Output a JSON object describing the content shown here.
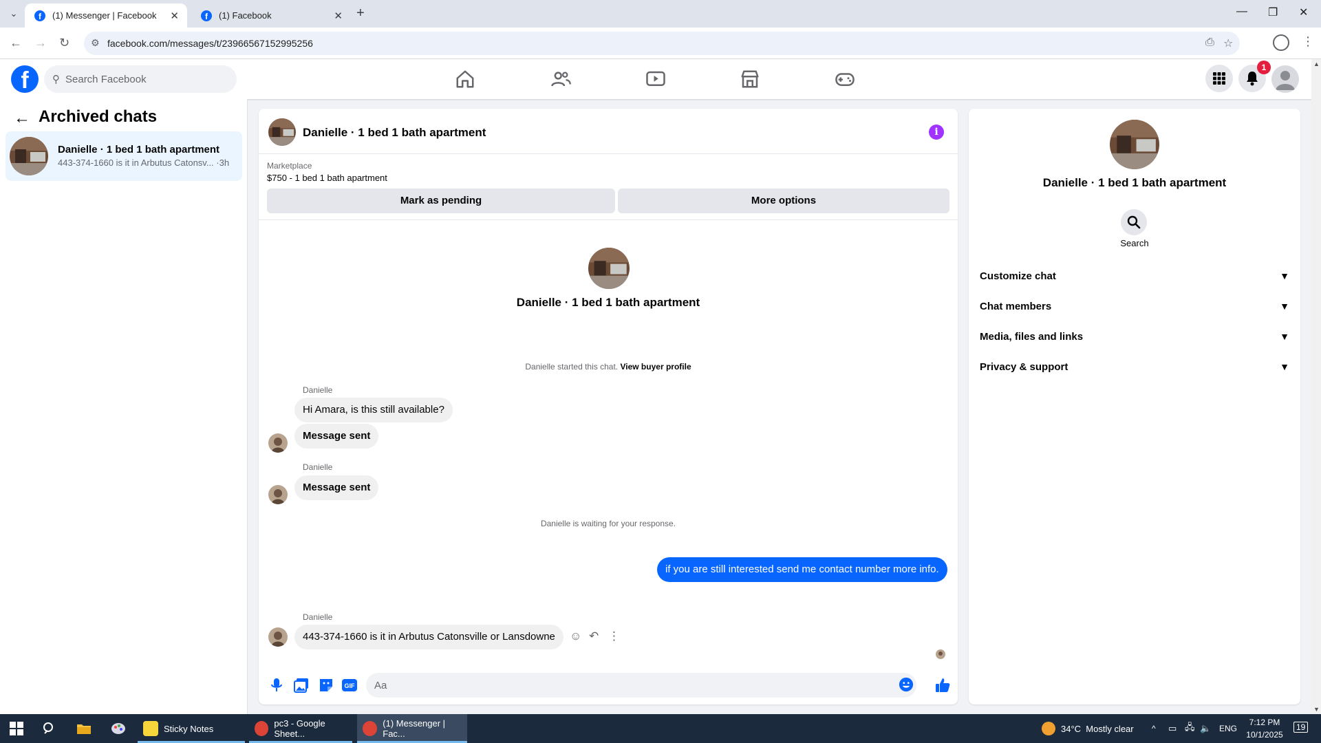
{
  "browser": {
    "tabs": [
      {
        "title": "(1) Messenger | Facebook",
        "active": true
      },
      {
        "title": "(1) Facebook",
        "active": false
      }
    ],
    "url": "facebook.com/messages/t/23966567152995256"
  },
  "header": {
    "search_placeholder": "Search Facebook",
    "notification_count": "1"
  },
  "left_panel": {
    "title": "Archived chats",
    "chats": [
      {
        "name": "Danielle · 1 bed 1 bath apartment",
        "preview": "443-374-1660 is it in Arbutus Catonsv... ·3h"
      }
    ]
  },
  "chat": {
    "title": "Danielle · 1 bed 1 bath apartment",
    "marketplace_label": "Marketplace",
    "listing": "$750 - 1 bed 1 bath apartment",
    "mark_pending_label": "Mark as pending",
    "more_options_label": "More options",
    "intro_name": "Danielle · 1 bed 1 bath apartment",
    "started_text": "Danielle started this chat.",
    "view_profile_label": "View buyer profile",
    "sender_name": "Danielle",
    "messages": [
      "Hi Amara, is this still available?",
      "Message sent",
      "Message sent"
    ],
    "waiting_text": "Danielle is waiting for your response.",
    "outgoing": "if you  are still interested send me contact number more info.",
    "last_message": "443-374-1660 is it in Arbutus Catonsville or Lansdowne",
    "composer_placeholder": "Aa"
  },
  "right_panel": {
    "name": "Danielle · 1 bed 1 bath apartment",
    "search_label": "Search",
    "sections": [
      "Customize chat",
      "Chat members",
      "Media, files and links",
      "Privacy & support"
    ]
  },
  "taskbar": {
    "apps": [
      "Sticky Notes",
      "pc3 - Google Sheet...",
      "(1) Messenger | Fac..."
    ],
    "weather": "34°C  Mostly clear",
    "language": "ENG",
    "time": "7:12 PM",
    "date": "10/1/2025",
    "notifications": "19"
  },
  "colors": {
    "facebook_blue": "#0866ff",
    "info_purple": "#a033ff",
    "badge_red": "#e41e3f"
  }
}
